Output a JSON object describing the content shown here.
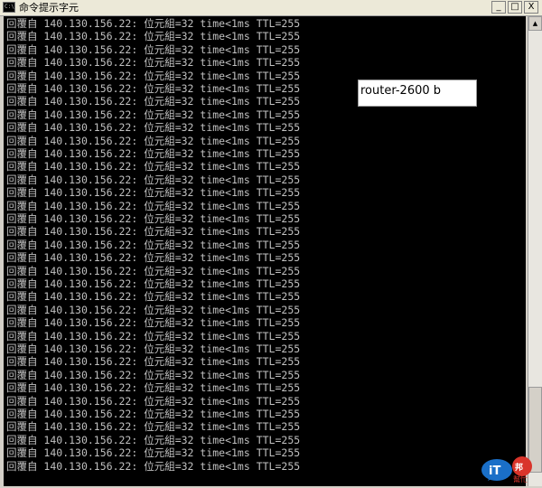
{
  "window": {
    "title": "命令提示字元",
    "icon_text": "C:\\",
    "minimize_symbol": "_",
    "maximize_symbol": "□",
    "close_symbol": "X"
  },
  "console": {
    "repeat_count": 35,
    "line_text": "回覆自 140.130.156.22: 位元組=32 time<1ms TTL=255"
  },
  "annotation": {
    "text": "router-2600 b"
  },
  "scrollbar": {
    "up_arrow": "▲"
  },
  "logo": {
    "brand": "iT邦幫忙",
    "name": "ithome-logo"
  },
  "colors": {
    "console_bg": "#000000",
    "console_fg": "#c0c0c0",
    "logo_blue": "#1a6fc8",
    "logo_red": "#d9342b"
  }
}
